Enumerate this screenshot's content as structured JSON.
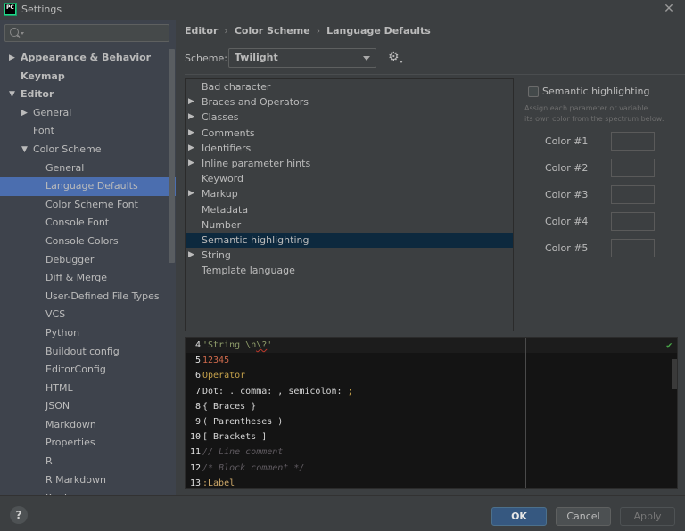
{
  "window": {
    "title": "Settings",
    "app_icon_text": "PC",
    "close_glyph": "✕"
  },
  "sidebar": {
    "search": {
      "value": "",
      "placeholder": ""
    },
    "items": [
      {
        "label": "Appearance & Behavior",
        "level": 0,
        "arrow": "▶",
        "bold": true
      },
      {
        "label": "Keymap",
        "level": 0,
        "arrow": "",
        "bold": true
      },
      {
        "label": "Editor",
        "level": 0,
        "arrow": "▼",
        "bold": true
      },
      {
        "label": "General",
        "level": 1,
        "arrow": "▶",
        "bold": false
      },
      {
        "label": "Font",
        "level": 1,
        "arrow": "",
        "bold": false
      },
      {
        "label": "Color Scheme",
        "level": 1,
        "arrow": "▼",
        "bold": false
      },
      {
        "label": "General",
        "level": 2,
        "arrow": "",
        "bold": false
      },
      {
        "label": "Language Defaults",
        "level": 2,
        "arrow": "",
        "bold": false,
        "selected": true
      },
      {
        "label": "Color Scheme Font",
        "level": 2,
        "arrow": "",
        "bold": false
      },
      {
        "label": "Console Font",
        "level": 2,
        "arrow": "",
        "bold": false
      },
      {
        "label": "Console Colors",
        "level": 2,
        "arrow": "",
        "bold": false
      },
      {
        "label": "Debugger",
        "level": 2,
        "arrow": "",
        "bold": false
      },
      {
        "label": "Diff & Merge",
        "level": 2,
        "arrow": "",
        "bold": false
      },
      {
        "label": "User-Defined File Types",
        "level": 2,
        "arrow": "",
        "bold": false
      },
      {
        "label": "VCS",
        "level": 2,
        "arrow": "",
        "bold": false
      },
      {
        "label": "Python",
        "level": 2,
        "arrow": "",
        "bold": false
      },
      {
        "label": "Buildout config",
        "level": 2,
        "arrow": "",
        "bold": false
      },
      {
        "label": "EditorConfig",
        "level": 2,
        "arrow": "",
        "bold": false
      },
      {
        "label": "HTML",
        "level": 2,
        "arrow": "",
        "bold": false
      },
      {
        "label": "JSON",
        "level": 2,
        "arrow": "",
        "bold": false
      },
      {
        "label": "Markdown",
        "level": 2,
        "arrow": "",
        "bold": false
      },
      {
        "label": "Properties",
        "level": 2,
        "arrow": "",
        "bold": false
      },
      {
        "label": "R",
        "level": 2,
        "arrow": "",
        "bold": false
      },
      {
        "label": "R Markdown",
        "level": 2,
        "arrow": "",
        "bold": false
      },
      {
        "label": "RegExp",
        "level": 2,
        "arrow": "",
        "bold": false
      }
    ]
  },
  "main": {
    "breadcrumb": [
      "Editor",
      "Color Scheme",
      "Language Defaults"
    ],
    "breadcrumb_sep": "›",
    "scheme_label": "Scheme:",
    "scheme_value": "Twilight",
    "gear_glyph": "⚙",
    "attributes": [
      {
        "label": "Bad character",
        "expandable": false
      },
      {
        "label": "Braces and Operators",
        "expandable": true
      },
      {
        "label": "Classes",
        "expandable": true
      },
      {
        "label": "Comments",
        "expandable": true
      },
      {
        "label": "Identifiers",
        "expandable": true
      },
      {
        "label": "Inline parameter hints",
        "expandable": true
      },
      {
        "label": "Keyword",
        "expandable": false
      },
      {
        "label": "Markup",
        "expandable": true
      },
      {
        "label": "Metadata",
        "expandable": false
      },
      {
        "label": "Number",
        "expandable": false
      },
      {
        "label": "Semantic highlighting",
        "expandable": false,
        "selected": true
      },
      {
        "label": "String",
        "expandable": true
      },
      {
        "label": "Template language",
        "expandable": false
      }
    ],
    "expand_glyph": "▶",
    "semantic": {
      "checkbox_label": "Semantic highlighting",
      "checked": false,
      "description_line1": "Assign each parameter or variable",
      "description_line2": "its own color from the spectrum below:",
      "colors": [
        "Color #1",
        "Color #2",
        "Color #3",
        "Color #4",
        "Color #5"
      ]
    },
    "preview": {
      "status_glyph": "✔",
      "lines": [
        {
          "n": "4",
          "parts": [
            {
              "t": "'String ",
              "c": "c-str"
            },
            {
              "t": "\\n",
              "c": "c-str"
            },
            {
              "t": "\\?",
              "c": "c-esc"
            },
            {
              "t": "'",
              "c": "c-str"
            }
          ]
        },
        {
          "n": "5",
          "parts": [
            {
              "t": "12345",
              "c": "c-num"
            }
          ]
        },
        {
          "n": "6",
          "parts": [
            {
              "t": "Operator",
              "c": "c-op"
            }
          ]
        },
        {
          "n": "7",
          "parts": [
            {
              "t": "Dot: . comma: , semicolon: ",
              "c": ""
            },
            {
              "t": ";",
              "c": "c-semi"
            }
          ]
        },
        {
          "n": "8",
          "parts": [
            {
              "t": "{ Braces }",
              "c": ""
            }
          ]
        },
        {
          "n": "9",
          "parts": [
            {
              "t": "( Parentheses )",
              "c": ""
            }
          ]
        },
        {
          "n": "10",
          "parts": [
            {
              "t": "[ Brackets ]",
              "c": ""
            }
          ]
        },
        {
          "n": "11",
          "parts": [
            {
              "t": "// Line comment",
              "c": "c-cmt"
            }
          ]
        },
        {
          "n": "12",
          "parts": [
            {
              "t": "/* Block comment */",
              "c": "c-cmt"
            }
          ]
        },
        {
          "n": "13",
          "parts": [
            {
              "t": ":Label",
              "c": "c-lbl"
            }
          ]
        }
      ]
    }
  },
  "footer": {
    "help_glyph": "?",
    "ok_label": "OK",
    "cancel_label": "Cancel",
    "apply_label": "Apply"
  }
}
